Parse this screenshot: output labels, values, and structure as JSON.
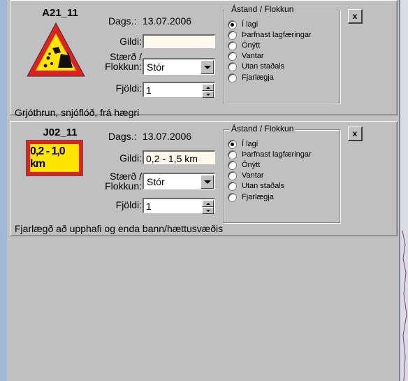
{
  "cards": [
    {
      "code": "A21_11",
      "date_label": "Dags.:",
      "date": "13.07.2006",
      "gildi_label": "Gildi:",
      "gildi_value": "",
      "size_label_1": "Stærð /",
      "size_label_2": "Flokkun:",
      "size_value": "Stór",
      "count_label": "Fjöldi:",
      "count_value": "1",
      "group_title": "Ástand / Flokkun",
      "options": [
        "Í lagi",
        "Þarfnast lagfæringar",
        "Ónýtt",
        "Vantar",
        "Utan staðals",
        "Fjarlægja"
      ],
      "selected_option": 0,
      "close_label": "x",
      "description": "Grjóthrun, snjóflóð, frá hægri",
      "sign_icon": "falling-rocks-warning-sign"
    },
    {
      "code": "J02_11",
      "date_label": "Dags.:",
      "date": "13.07.2006",
      "gildi_label": "Gildi:",
      "gildi_value": "0,2 - 1,5 km",
      "size_label_1": "Stærð /",
      "size_label_2": "Flokkun:",
      "size_value": "Stór",
      "count_label": "Fjöldi:",
      "count_value": "1",
      "group_title": "Ástand / Flokkun",
      "options": [
        "Í lagi",
        "Þarfnast lagfæringar",
        "Ónýtt",
        "Vantar",
        "Utan staðals",
        "Fjarlægja"
      ],
      "selected_option": 0,
      "close_label": "x",
      "description": "Fjarlægð að upphafi og enda bann/hættusvæðis",
      "sign_text": "0,2 - 1,0 km",
      "sign_icon": "distance-plate-sign"
    }
  ],
  "colors": {
    "panel_bg": "#c0c0c0",
    "sign_red": "#e12020",
    "sign_yellow": "#ffe600",
    "textbox_bg": "#fff8ea"
  }
}
